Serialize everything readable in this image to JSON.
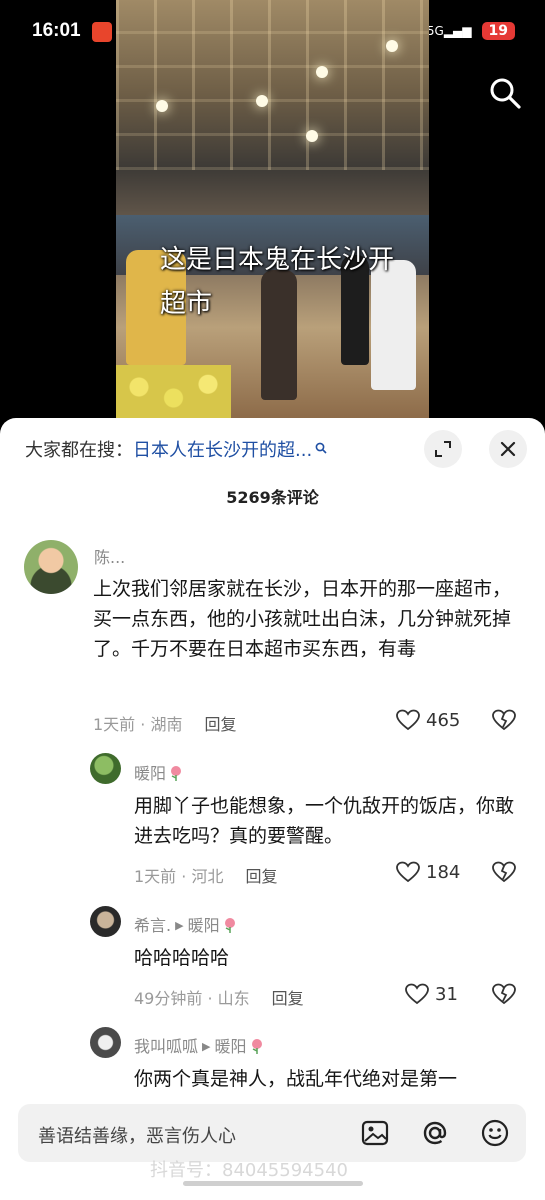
{
  "status": {
    "time": "16:01",
    "battery": "19",
    "signal": "5G"
  },
  "video": {
    "caption": "这是日本鬼在长沙开超市"
  },
  "search_bar": {
    "prefix": "大家都在搜：",
    "query": "日本人在长沙开的超..."
  },
  "comments_header": {
    "count": "5269条评论"
  },
  "comments": [
    {
      "user": "陈...",
      "text": "上次我们邻居家就在长沙，日本开的那一座超市，买一点东西，他的小孩就吐出白沫，几分钟就死掉了。千万不要在日本超市买东西，有毒",
      "time": "1天前 · 湖南",
      "reply": "回复",
      "likes": "465"
    },
    {
      "user": "暖阳",
      "text": "用脚丫子也能想象，一个仇敌开的饭店，你敢进去吃吗？真的要警醒。",
      "time": "1天前 · 河北",
      "reply": "回复",
      "likes": "184"
    },
    {
      "user": "希言.",
      "reply_to": "暖阳",
      "text": "哈哈哈哈哈",
      "time": "49分钟前 · 山东",
      "reply": "回复",
      "likes": "31"
    },
    {
      "user": "我叫呱呱",
      "reply_to": "暖阳",
      "text": "你两个真是神人，战乱年代绝对是第一"
    }
  ],
  "input": {
    "placeholder": "善语结善缘，恶言伤人心"
  },
  "watermark": "抖音号：84045594540",
  "colors": {
    "link": "#1f4fa3",
    "battery": "#e53935",
    "sheet": "#ffffff"
  }
}
